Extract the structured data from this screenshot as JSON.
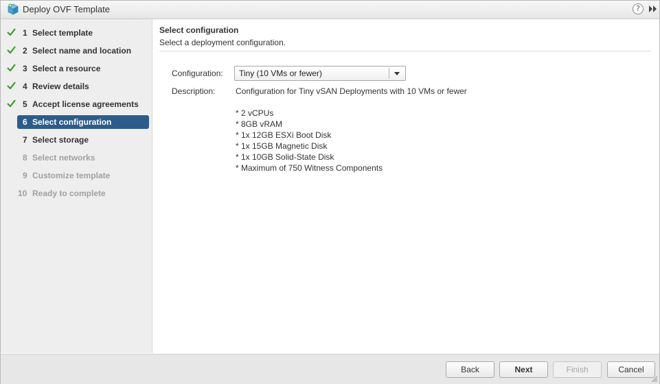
{
  "window": {
    "title": "Deploy OVF Template",
    "help_glyph": "?"
  },
  "steps": [
    {
      "num": "1",
      "label": "Select template",
      "state": "done"
    },
    {
      "num": "2",
      "label": "Select name and location",
      "state": "done"
    },
    {
      "num": "3",
      "label": "Select a resource",
      "state": "done"
    },
    {
      "num": "4",
      "label": "Review details",
      "state": "done"
    },
    {
      "num": "5",
      "label": "Accept license agreements",
      "state": "done"
    },
    {
      "num": "6",
      "label": "Select configuration",
      "state": "active"
    },
    {
      "num": "7",
      "label": "Select storage",
      "state": "next"
    },
    {
      "num": "8",
      "label": "Select networks",
      "state": "disabled"
    },
    {
      "num": "9",
      "label": "Customize template",
      "state": "disabled"
    },
    {
      "num": "10",
      "label": "Ready to complete",
      "state": "disabled"
    }
  ],
  "main": {
    "title": "Select configuration",
    "subtitle": "Select a deployment configuration.",
    "configuration_label": "Configuration:",
    "configuration_value": "Tiny (10 VMs or fewer)",
    "description_label": "Description:",
    "description_text": "Configuration for Tiny vSAN Deployments with 10 VMs or fewer",
    "specs": [
      "* 2 vCPUs",
      "* 8GB vRAM",
      "* 1x 12GB ESXi Boot Disk",
      "* 1x 15GB Magnetic Disk",
      "* 1x 10GB Solid-State Disk",
      "* Maximum of 750 Witness Components"
    ]
  },
  "footer": {
    "back_label": "Back",
    "next_label": "Next",
    "finish_label": "Finish",
    "cancel_label": "Cancel"
  },
  "colors": {
    "active_step_bg": "#2d5c8a",
    "check_green": "#3a9a2a"
  }
}
